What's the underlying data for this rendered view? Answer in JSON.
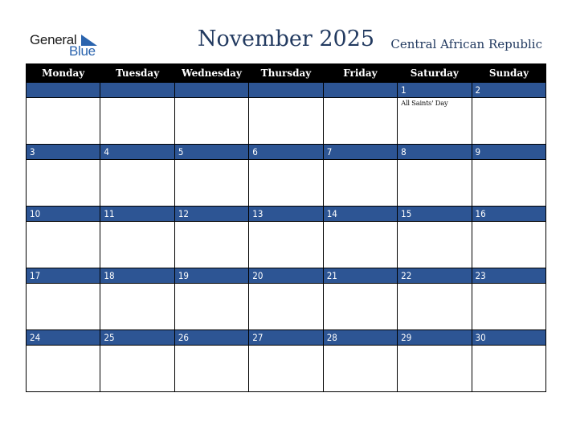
{
  "logo": {
    "word1": "General",
    "word2": "Blue"
  },
  "title": "November 2025",
  "country": "Central African Republic",
  "colors": {
    "header_bg": "#000000",
    "day_bar": "#2d5594",
    "title_text": "#223a60",
    "logo_blue": "#2b64ae"
  },
  "weekdays": [
    "Monday",
    "Tuesday",
    "Wednesday",
    "Thursday",
    "Friday",
    "Saturday",
    "Sunday"
  ],
  "weeks": [
    [
      {
        "day": ""
      },
      {
        "day": ""
      },
      {
        "day": ""
      },
      {
        "day": ""
      },
      {
        "day": ""
      },
      {
        "day": "1",
        "holiday": "All Saints' Day"
      },
      {
        "day": "2"
      }
    ],
    [
      {
        "day": "3"
      },
      {
        "day": "4"
      },
      {
        "day": "5"
      },
      {
        "day": "6"
      },
      {
        "day": "7"
      },
      {
        "day": "8"
      },
      {
        "day": "9"
      }
    ],
    [
      {
        "day": "10"
      },
      {
        "day": "11"
      },
      {
        "day": "12"
      },
      {
        "day": "13"
      },
      {
        "day": "14"
      },
      {
        "day": "15"
      },
      {
        "day": "16"
      }
    ],
    [
      {
        "day": "17"
      },
      {
        "day": "18"
      },
      {
        "day": "19"
      },
      {
        "day": "20"
      },
      {
        "day": "21"
      },
      {
        "day": "22"
      },
      {
        "day": "23"
      }
    ],
    [
      {
        "day": "24"
      },
      {
        "day": "25"
      },
      {
        "day": "26"
      },
      {
        "day": "27"
      },
      {
        "day": "28"
      },
      {
        "day": "29"
      },
      {
        "day": "30"
      }
    ]
  ]
}
